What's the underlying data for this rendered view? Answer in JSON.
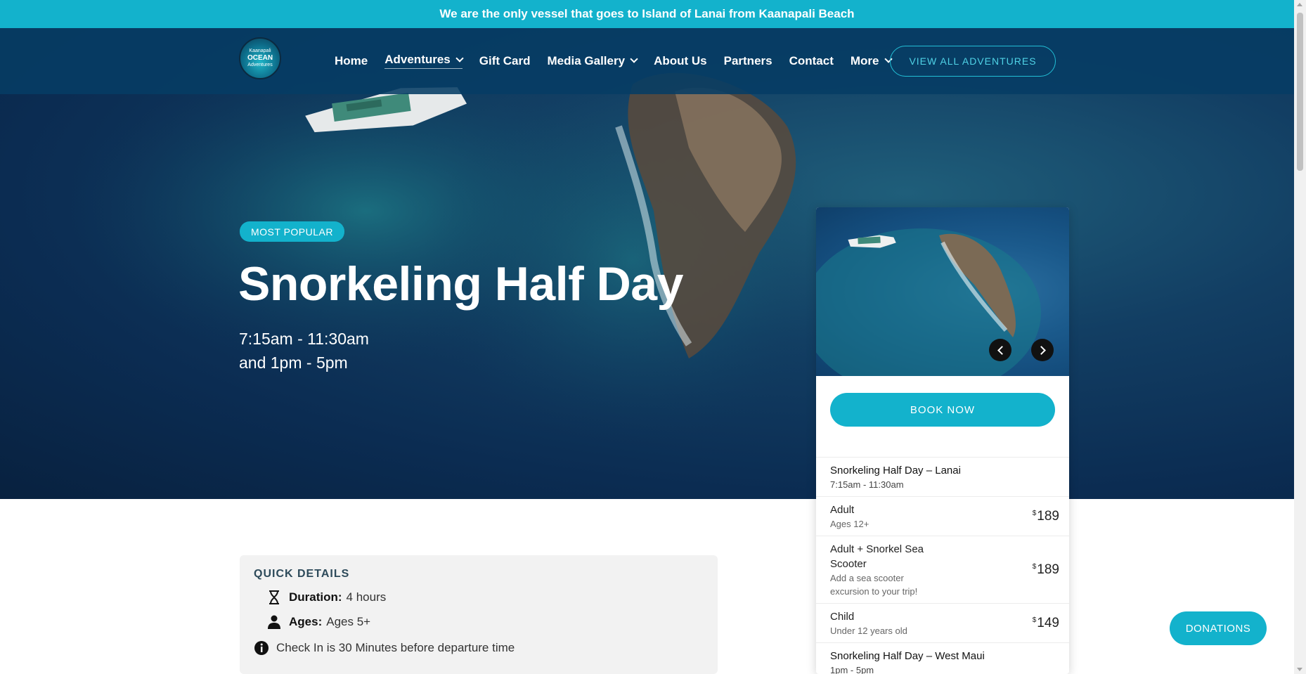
{
  "announcement": "We are the only vessel that goes to Island of Lanai from Kaanapali Beach",
  "logo": {
    "line1": "Kaanapali",
    "line2": "OCEAN",
    "line3": "Adventures"
  },
  "nav": {
    "items": [
      {
        "label": "Home"
      },
      {
        "label": "Adventures"
      },
      {
        "label": "Gift Card"
      },
      {
        "label": "Media Gallery"
      },
      {
        "label": "About Us"
      },
      {
        "label": "Partners"
      },
      {
        "label": "Contact"
      },
      {
        "label": "More"
      }
    ],
    "cta": "VIEW ALL ADVENTURES"
  },
  "hero": {
    "badge": "MOST POPULAR",
    "title": "Snorkeling Half Day",
    "time_line1": "7:15am - 11:30am",
    "time_line2": "and 1pm - 5pm"
  },
  "booking": {
    "book_label": "BOOK NOW",
    "rows": [
      {
        "name": "Snorkeling Half Day – Lanai",
        "sub": "7:15am - 11:30am",
        "currency": "",
        "price": ""
      },
      {
        "name": "Adult",
        "sub": "Ages 12+",
        "currency": "$",
        "price": "189"
      },
      {
        "name": "Adult + Snorkel Sea Scooter",
        "sub": "Add a sea scooter excursion to your trip!",
        "currency": "$",
        "price": "189"
      },
      {
        "name": "Child",
        "sub": "Under 12 years old",
        "currency": "$",
        "price": "149"
      },
      {
        "name": "Snorkeling Half Day – West Maui",
        "sub": "1pm - 5pm",
        "currency": "",
        "price": ""
      }
    ]
  },
  "quick_details": {
    "title": "QUICK DETAILS",
    "duration_label": "Duration:",
    "duration_value": "4 hours",
    "ages_label": "Ages:",
    "ages_value": "Ages 5+",
    "checkin": "Check In is 30 Minutes before departure time"
  },
  "donations": "DONATIONS",
  "colors": {
    "accent": "#13b2cc",
    "nav_bg": "#063c64",
    "ocean": "#0b2c52"
  },
  "icons": [
    "hourglass-icon",
    "person-icon",
    "info-icon",
    "chevron-down-icon",
    "chevron-left-icon",
    "chevron-right-icon"
  ]
}
